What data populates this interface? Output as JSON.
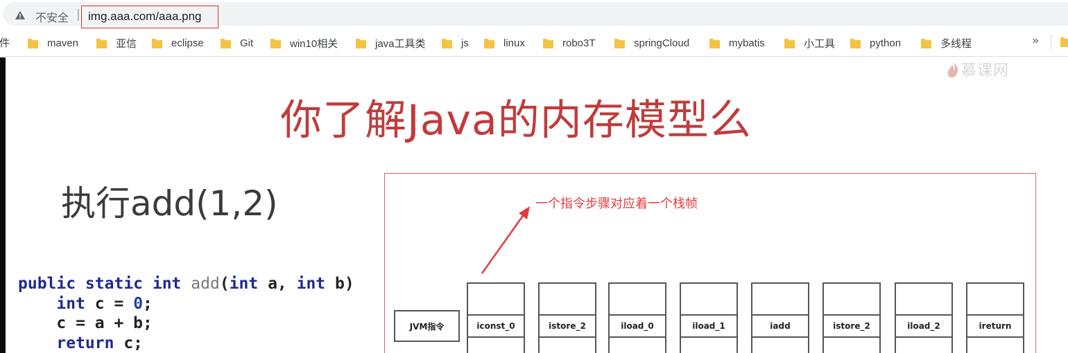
{
  "browser": {
    "security_label": "不安全",
    "separator": "|",
    "url": "img.aaa.com/aaa.png"
  },
  "bookmarks": {
    "first_partial": "文件",
    "items": [
      {
        "label": "maven"
      },
      {
        "label": "亚信"
      },
      {
        "label": "eclipse"
      },
      {
        "label": "Git"
      },
      {
        "label": "win10相关"
      },
      {
        "label": "java工具类"
      },
      {
        "label": "js"
      },
      {
        "label": "linux"
      },
      {
        "label": "robo3T"
      },
      {
        "label": "springCloud"
      },
      {
        "label": "mybatis"
      },
      {
        "label": "小工具"
      },
      {
        "label": "python"
      },
      {
        "label": "多线程"
      }
    ],
    "overflow": "»"
  },
  "slide": {
    "logo": "慕课网",
    "title": "你了解Java的内存模型么",
    "subtitle": "执行add(1,2)",
    "code": {
      "line1": {
        "kw1": "public static int",
        "fn": "add",
        "open": "(",
        "kw2": "int",
        "a": " a, ",
        "kw3": "int",
        "b": " b)"
      },
      "line2": {
        "kw": "int",
        "rest": " c = ",
        "num": "0",
        "end": ";"
      },
      "line3": "c = a + b;",
      "line4": {
        "kw": "return",
        "rest": " c;"
      }
    },
    "diagram": {
      "annotation": "一个指令步骤对应着一个栈帧",
      "row_label": "JVM指令",
      "instructions": [
        "iconst_0",
        "istore_2",
        "iload_0",
        "iload_1",
        "iadd",
        "istore_2",
        "iload_2",
        "ireturn"
      ]
    }
  },
  "colors": {
    "title_red": "#c13b3b",
    "annotation_red": "#e33b3b",
    "folder_yellow": "#f5c343",
    "keyword_blue": "#1f2a8f"
  }
}
